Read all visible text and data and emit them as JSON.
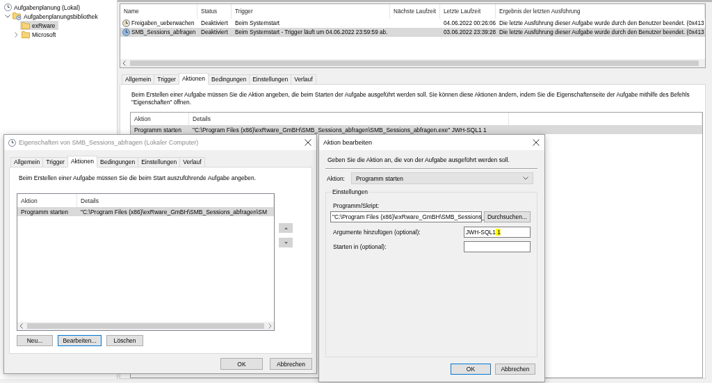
{
  "tree": [
    {
      "label": "Aufgabenplanung (Lokal)",
      "kind": "root",
      "selected": false,
      "children": [
        {
          "label": "Aufgabenplanungsbibliothek",
          "kind": "library",
          "expanded": true,
          "selected": false,
          "children": [
            {
              "label": "exRware",
              "kind": "folder",
              "selected": true
            },
            {
              "label": "Microsoft",
              "kind": "folder",
              "expanded": false,
              "selected": false
            }
          ]
        }
      ]
    }
  ],
  "task_table": {
    "columns": [
      "Name",
      "Status",
      "Trigger",
      "Nächste Laufzeit",
      "Letzte Laufzeit",
      "Ergebnis der letzten Ausführung"
    ],
    "rows": [
      {
        "name": "Freigaben_ueberwachen",
        "status": "Deaktiviert",
        "trigger": "Beim Systemstart",
        "last_run": "04.06.2022 00:26:06",
        "result": "Die letzte Ausführung dieser Aufgabe wurde durch den Benutzer beendet. (0x413",
        "selected": false
      },
      {
        "name": "SMB_Sessions_abfragen",
        "status": "Deaktiviert",
        "trigger": "Beim Systemstart - Trigger läuft um 04.06.2022 23:59:59 ab.",
        "last_run": "03.06.2022 23:39:28",
        "result": "Die letzte Ausführung dieser Aufgabe wurde durch den Benutzer beendet. (0x413",
        "selected": true
      }
    ]
  },
  "details_pane": {
    "tabs": [
      {
        "label": "Allgemein",
        "selected": false
      },
      {
        "label": "Trigger",
        "selected": false
      },
      {
        "label": "Aktionen",
        "selected": true
      },
      {
        "label": "Bedingungen",
        "selected": false
      },
      {
        "label": "Einstellungen",
        "selected": false
      },
      {
        "label": "Verlauf",
        "selected": false
      }
    ],
    "description": "Beim Erstellen einer Aufgabe müssen Sie die Aktion angeben, die beim Starten der Aufgabe ausgeführt werden soll. Sie können diese Aktionen ändern, indem Sie die Eigenschaftenseite der Aufgabe mithilfe des Befehls \"Eigenschaften\" öffnen.",
    "actions_table": {
      "columns": [
        "Aktion",
        "Details"
      ],
      "rows": [
        {
          "action": "Programm starten",
          "details": "\"C:\\Program Files (x86)\\exRware_GmBH\\SMB_Sessions_abfragen\\SMB_Sessions_abfragen.exe\" JWH-SQL1 1",
          "selected": true
        }
      ]
    }
  },
  "properties_dialog": {
    "title": "Eigenschaften von SMB_Sessions_abfragen (Lokaler Computer)",
    "active": false,
    "tabs": [
      {
        "label": "Allgemein",
        "selected": false
      },
      {
        "label": "Trigger",
        "selected": false
      },
      {
        "label": "Aktionen",
        "selected": true
      },
      {
        "label": "Bedingungen",
        "selected": false
      },
      {
        "label": "Einstellungen",
        "selected": false
      },
      {
        "label": "Verlauf",
        "selected": false
      }
    ],
    "description": "Beim Erstellen einer Aufgabe müssen Sie die beim Start auszuführende Aufgabe angeben.",
    "list": {
      "columns": [
        "Aktion",
        "Details"
      ],
      "rows": [
        {
          "action": "Programm starten",
          "details": "\"C:\\Program Files (x86)\\exRware_GmBH\\SMB_Sessions_abfragen\\SM",
          "selected": true
        }
      ]
    },
    "buttons": [
      {
        "label": "Neu...",
        "focused": false
      },
      {
        "label": "Bearbeiten...",
        "focused": true
      },
      {
        "label": "Löschen",
        "focused": false
      }
    ],
    "footer_buttons": [
      {
        "label": "OK",
        "focused": false
      },
      {
        "label": "Abbrechen",
        "focused": false
      }
    ]
  },
  "edit_action_dialog": {
    "title": "Aktion bearbeiten",
    "active": true,
    "description": "Geben Sie die Aktion an, die von der Aufgabe ausgeführt werden soll.",
    "action": {
      "label": "Aktion:",
      "value": "Programm starten"
    },
    "settings": {
      "title": "Einstellungen",
      "program": {
        "label": "Programm/Skript:",
        "value": "\"C:\\Program Files (x86)\\exRware_GmBH\\SMB_Sessions_"
      },
      "browse_button": "Durchsuchen...",
      "arguments": {
        "label": "Argumente hinzufügen (optional):",
        "value": [
          {
            "text": "JWH-SQL1",
            "highlighted": false
          },
          {
            "text": " 1",
            "highlighted": true
          }
        ]
      },
      "start_in": {
        "label": "Starten in (optional):"
      }
    },
    "footer_buttons": [
      {
        "label": "OK",
        "focused": true
      },
      {
        "label": "Abbrechen",
        "focused": false
      }
    ]
  }
}
